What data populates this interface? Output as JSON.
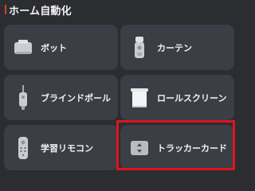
{
  "section": {
    "title": "ホーム自動化"
  },
  "devices": [
    {
      "label": "ボット",
      "icon": "bot-icon"
    },
    {
      "label": "カーテン",
      "icon": "curtain-icon"
    },
    {
      "label": "ブラインドポール",
      "icon": "blind-pole-icon"
    },
    {
      "label": "ロールスクリーン",
      "icon": "roll-screen-icon"
    },
    {
      "label": "学習リモコン",
      "icon": "remote-control-icon"
    },
    {
      "label": "トラッカーカード",
      "icon": "tracker-card-icon"
    }
  ],
  "colors": {
    "background": "#2b2d31",
    "card": "#3b3e45",
    "accent": "#e53935",
    "highlight_border": "#e0131b"
  }
}
